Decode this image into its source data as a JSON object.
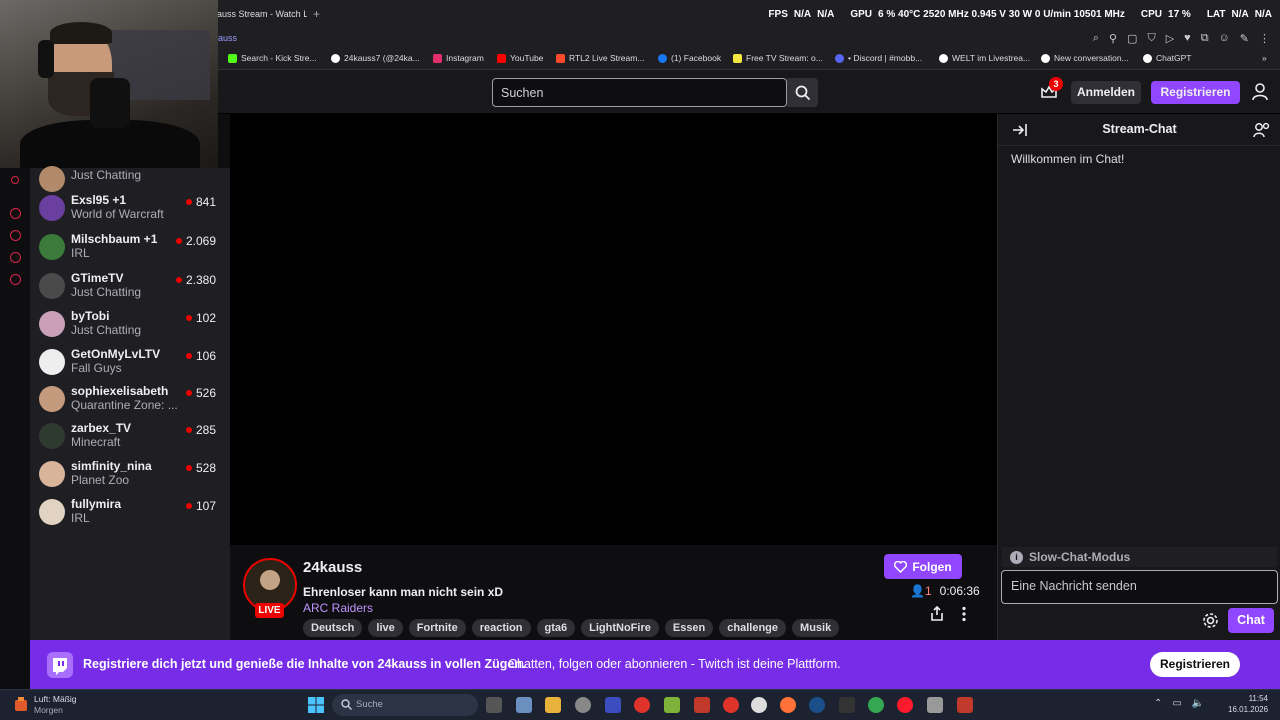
{
  "browser": {
    "tab_title": "auss Stream - Watch L",
    "url": "auss",
    "bookmarks": [
      {
        "label": "Search - Kick Stre...",
        "color": "#53fc18"
      },
      {
        "label": "24kauss7 (@24ka...",
        "color": "#ffffff"
      },
      {
        "label": "Instagram",
        "color": "#e1306c"
      },
      {
        "label": "YouTube",
        "color": "#ff0000"
      },
      {
        "label": "RTL2 Live Stream...",
        "color": "#ff4b2b"
      },
      {
        "label": "(1) Facebook",
        "color": "#1877f2"
      },
      {
        "label": "Free TV Stream: o...",
        "color": "#f5e642"
      },
      {
        "label": "• Discord | #mobb...",
        "color": "#5865f2"
      },
      {
        "label": "WELT im Livestrea...",
        "color": "#ffffff"
      },
      {
        "label": "New conversation...",
        "color": "#ffffff"
      },
      {
        "label": "ChatGPT",
        "color": "#ffffff"
      }
    ]
  },
  "overlay_stats": {
    "fps_label": "FPS",
    "fps": "N/A",
    "fps2": "N/A",
    "gpu_label": "GPU",
    "gpu": "6 % 40°C 2520 MHz 0.945 V 30 W 0 U/min 10501 MHz",
    "cpu_label": "CPU",
    "cpu": "17 %",
    "lat_label": "LAT",
    "lat": "N/A",
    "lat2": "N/A"
  },
  "header": {
    "search_placeholder": "Suchen",
    "notification_count": "3",
    "login_label": "Anmelden",
    "register_label": "Registrieren"
  },
  "sidebar": {
    "channels": [
      {
        "name": "",
        "game": "Just Chatting",
        "viewers": "",
        "avatar": "#b08a6a"
      },
      {
        "name": "Exsl95 +1",
        "game": "World of Warcraft",
        "viewers": "841",
        "avatar": "#6b3fa0"
      },
      {
        "name": "Milschbaum +1",
        "game": "IRL",
        "viewers": "2.069",
        "avatar": "#3b7a3b"
      },
      {
        "name": "GTimeTV",
        "game": "Just Chatting",
        "viewers": "2.380",
        "avatar": "#4a4a4a"
      },
      {
        "name": "byTobi",
        "game": "Just Chatting",
        "viewers": "102",
        "avatar": "#caa0b8"
      },
      {
        "name": "GetOnMyLvLTV",
        "game": "Fall Guys",
        "viewers": "106",
        "avatar": "#eeeeee"
      },
      {
        "name": "sophiexelisabeth",
        "game": "Quarantine Zone: ...",
        "viewers": "526",
        "avatar": "#c49a7c"
      },
      {
        "name": "zarbex_TV",
        "game": "Minecraft",
        "viewers": "285",
        "avatar": "#2d3a2d"
      },
      {
        "name": "simfinity_nina",
        "game": "Planet Zoo",
        "viewers": "528",
        "avatar": "#d8b49a"
      },
      {
        "name": "fullymira",
        "game": "IRL",
        "viewers": "107",
        "avatar": "#e2d2c2"
      }
    ]
  },
  "stream": {
    "live_label": "LIVE",
    "streamer": "24kauss",
    "title": "Ehrenloser kann man nicht sein xD",
    "game": "ARC Raiders",
    "tags": [
      "Deutsch",
      "live",
      "Fortnite",
      "reaction",
      "gta6",
      "LightNoFire",
      "Essen",
      "challenge",
      "Musik"
    ],
    "follow_label": "Folgen",
    "viewers": "1",
    "uptime": "0:06:36"
  },
  "chat": {
    "title": "Stream-Chat",
    "welcome": "Willkommen im Chat!",
    "slow_mode": "Slow-Chat-Modus",
    "input_placeholder": "Eine Nachricht senden",
    "send_label": "Chat"
  },
  "banner": {
    "headline": "Registriere dich jetzt und genieße die Inhalte von 24kauss in vollen Zügen.",
    "sub": "Chatten, folgen oder abonnieren - Twitch ist deine Plattform.",
    "button": "Registrieren"
  },
  "taskbar": {
    "weather_line1": "Luft: Mäßig",
    "weather_line2": "Morgen",
    "search_label": "Suche",
    "time": "11:54",
    "date": "16.01.2026",
    "apps": [
      "file-explorer",
      "notepad",
      "folder",
      "v-app",
      "app-red",
      "mouse",
      "cube-app",
      "media-app",
      "app-red2",
      "chrome-like",
      "ubisoft",
      "firefox",
      "steam",
      "epic",
      "chrome",
      "opera",
      "network-app",
      "wifi-app"
    ]
  }
}
